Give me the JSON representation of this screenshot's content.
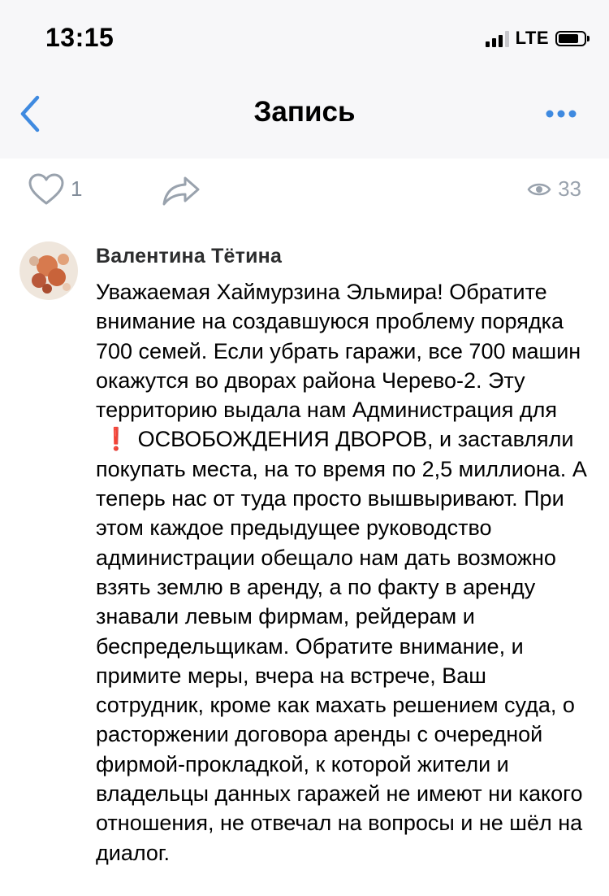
{
  "status_bar": {
    "time": "13:15",
    "network": "LTE",
    "icons": [
      "signal-icon",
      "battery-icon"
    ]
  },
  "nav": {
    "title": "Запись",
    "icons": [
      "back-chevron-icon",
      "more-dots-icon"
    ],
    "accent_color": "#3f8ae0"
  },
  "post_actions": {
    "likes": "1",
    "views": "33",
    "icons": [
      "heart-icon",
      "share-arrow-icon",
      "eye-icon"
    ]
  },
  "comment": {
    "author": "Валентина Тётина",
    "text_before": "Уважаемая Хаймурзина Эльмира! Обратите внимание на создавшуюся проблему порядка 700 семей. Если убрать гаражи, все 700 машин окажутся во дворах района Черево-2. Эту территорию выдала нам Администрация для",
    "emoji": "❗",
    "text_after": "ОСВОБОЖДЕНИЯ ДВОРОВ, и заставляли покупать места, на то время по 2,5 миллиона. А теперь нас от туда просто вышвыривают. При этом каждое предыдущее руководство администрации обещало нам дать возможно взять землю в аренду, а по факту в аренду знавали левым фирмам, рейдерам и беспредельщикам. Обратите внимание, и примите меры, вчера на встрече, Ваш сотрудник, кроме как махать решением суда, о расторжении договора аренды с очередной фирмой-прокладкой, к которой жители и владельцы данных гаражей не имеют ни какого отношения, не отвечал на вопросы и не шёл на диалог."
  }
}
